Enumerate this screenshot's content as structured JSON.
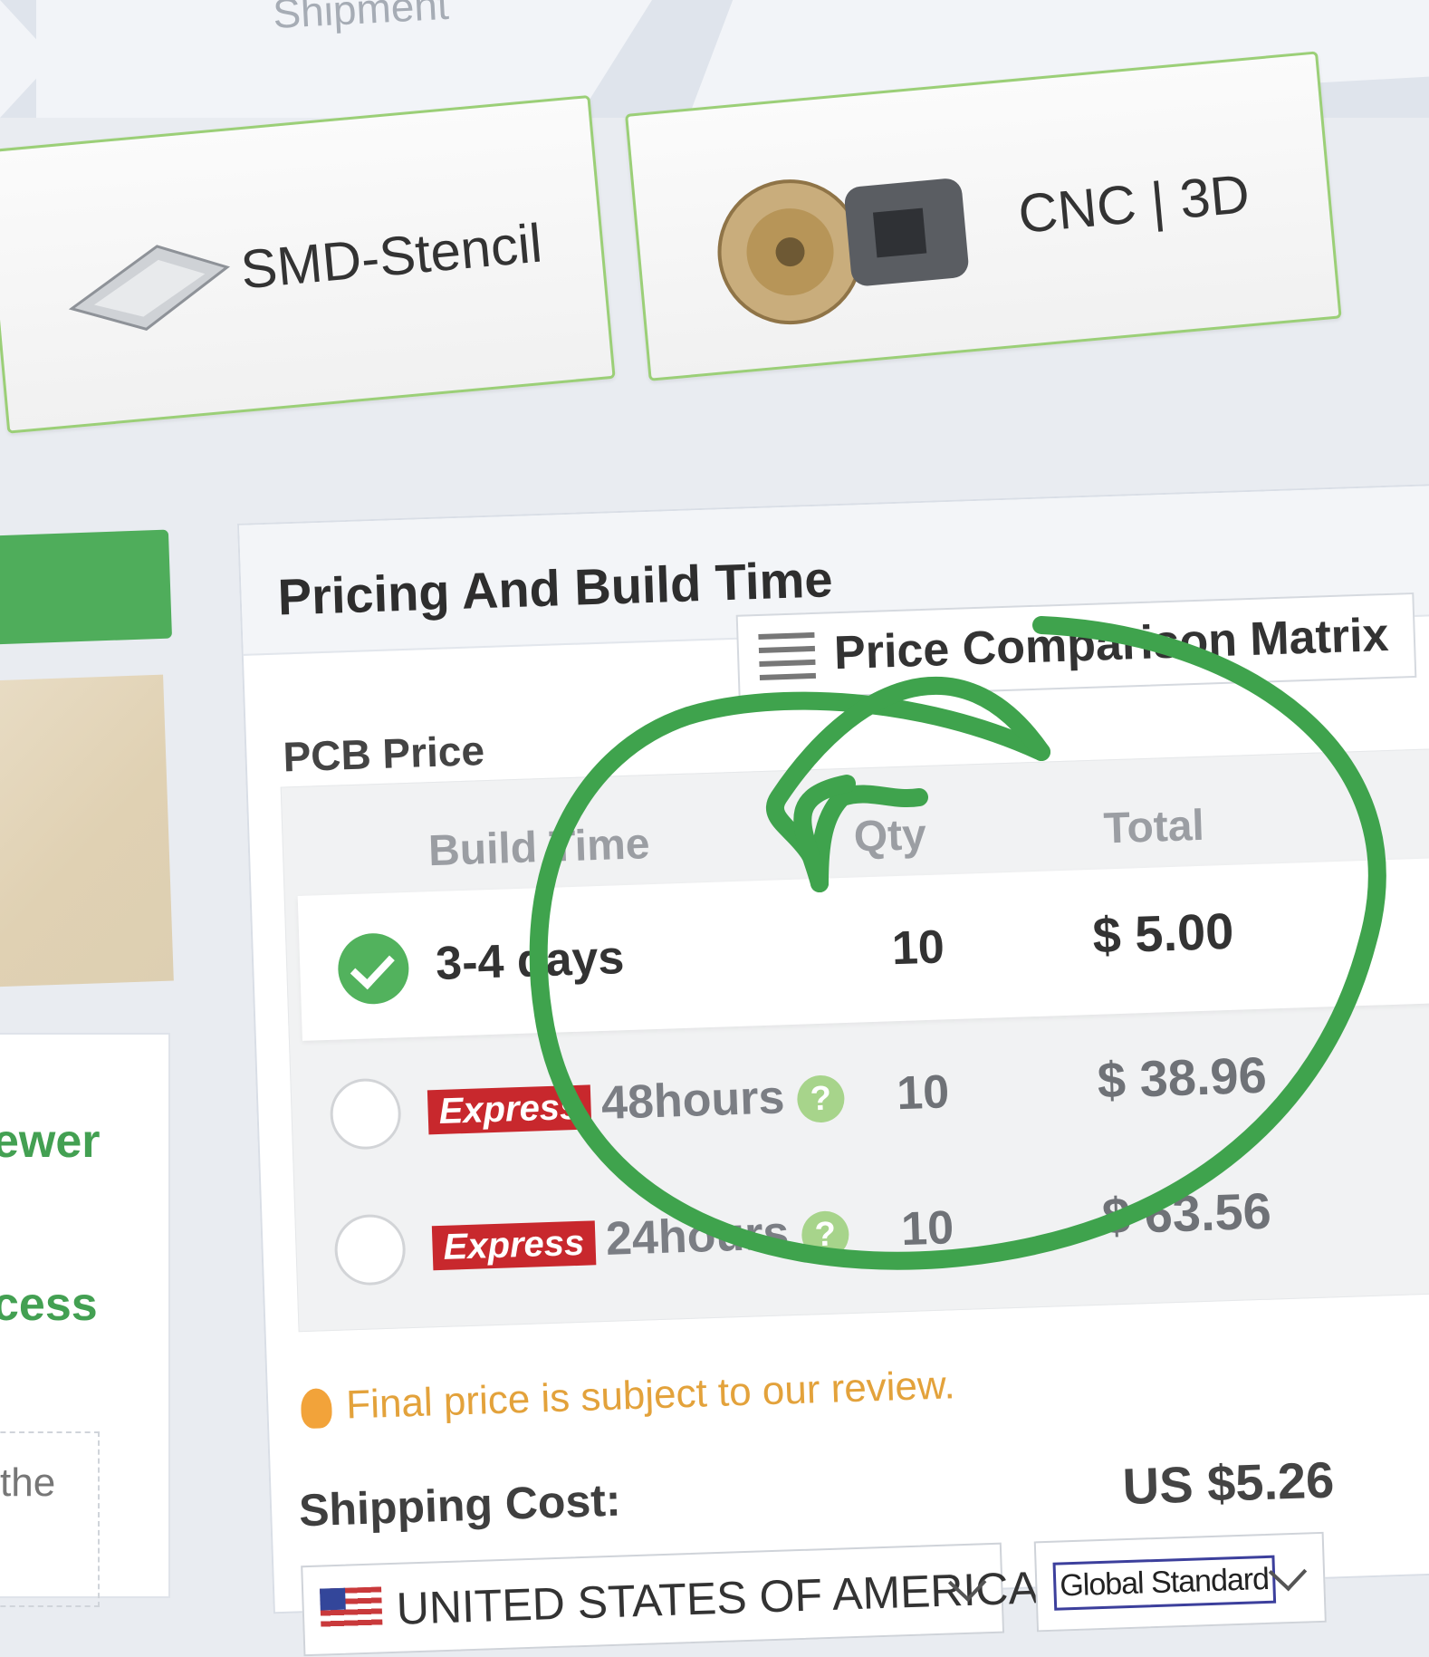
{
  "breadcrumb": {
    "step_label": "Shipment"
  },
  "products": [
    {
      "label": "SMD-Stencil",
      "icon": "stencil-icon"
    },
    {
      "label": "CNC | 3D",
      "icon": "cnc-parts-icon"
    }
  ],
  "sidebar": {
    "links": [
      "ewer",
      "cess"
    ],
    "snippet": "the"
  },
  "pricing": {
    "title": "Pricing And Build Time",
    "comparison_button": "Price Comparison Matrix",
    "pcb_price_label": "PCB Price",
    "headers": {
      "build_time": "Build Time",
      "qty": "Qty",
      "total": "Total"
    },
    "rows": [
      {
        "badge": "",
        "build_time": "3-4 days",
        "qty": "10",
        "total": "$ 5.00",
        "selected": true
      },
      {
        "badge": "Express",
        "build_time": "48hours",
        "qty": "10",
        "total": "$ 38.96",
        "selected": false
      },
      {
        "badge": "Express",
        "build_time": "24hours",
        "qty": "10",
        "total": "$ 63.56",
        "selected": false
      }
    ],
    "help_icon": "?",
    "notice": "Final price is subject to our review."
  },
  "shipping": {
    "label": "Shipping Cost:",
    "cost": "US $5.26",
    "country": "UNITED STATES OF AMERICA",
    "method": "Global Standard"
  },
  "colors": {
    "accent_green": "#4fad5b",
    "express_red": "#c8282d",
    "tip_orange": "#e3a23b"
  }
}
